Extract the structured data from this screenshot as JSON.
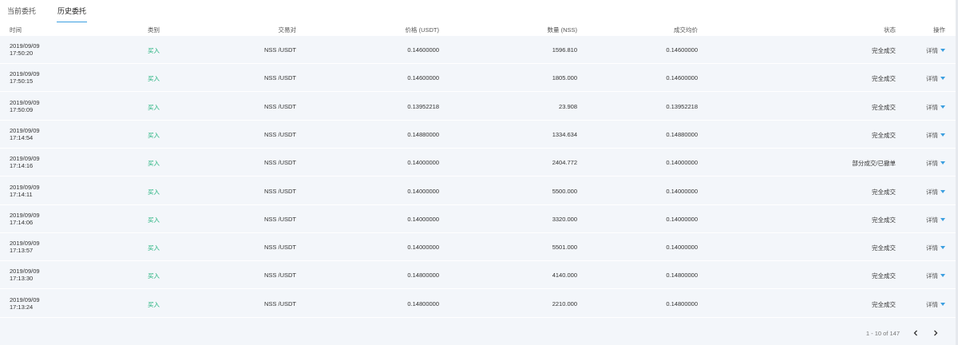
{
  "tabs": [
    {
      "label": "当前委托",
      "active": false
    },
    {
      "label": "历史委托",
      "active": true
    }
  ],
  "columns": {
    "time": "时间",
    "type": "类别",
    "pair": "交易对",
    "price": "价格 (USDT)",
    "qty": "数量 (NSS)",
    "avg": "成交均价",
    "status": "状态",
    "op": "操作"
  },
  "rows": [
    {
      "date": "2019/09/09",
      "time": "17:50:20",
      "type": "买入",
      "pair": "NSS /USDT",
      "price": "0.14600000",
      "qty": "1596.810",
      "avg": "0.14600000",
      "status": "完全成交",
      "op": "详情"
    },
    {
      "date": "2019/09/09",
      "time": "17:50:15",
      "type": "买入",
      "pair": "NSS /USDT",
      "price": "0.14600000",
      "qty": "1805.000",
      "avg": "0.14600000",
      "status": "完全成交",
      "op": "详情"
    },
    {
      "date": "2019/09/09",
      "time": "17:50:09",
      "type": "买入",
      "pair": "NSS /USDT",
      "price": "0.13952218",
      "qty": "23.908",
      "avg": "0.13952218",
      "status": "完全成交",
      "op": "详情"
    },
    {
      "date": "2019/09/09",
      "time": "17:14:54",
      "type": "买入",
      "pair": "NSS /USDT",
      "price": "0.14880000",
      "qty": "1334.634",
      "avg": "0.14880000",
      "status": "完全成交",
      "op": "详情"
    },
    {
      "date": "2019/09/09",
      "time": "17:14:16",
      "type": "买入",
      "pair": "NSS /USDT",
      "price": "0.14000000",
      "qty": "2404.772",
      "avg": "0.14000000",
      "status": "部分成交/已撤单",
      "op": "详情"
    },
    {
      "date": "2019/09/09",
      "time": "17:14:11",
      "type": "买入",
      "pair": "NSS /USDT",
      "price": "0.14000000",
      "qty": "5500.000",
      "avg": "0.14000000",
      "status": "完全成交",
      "op": "详情"
    },
    {
      "date": "2019/09/09",
      "time": "17:14:06",
      "type": "买入",
      "pair": "NSS /USDT",
      "price": "0.14000000",
      "qty": "3320.000",
      "avg": "0.14000000",
      "status": "完全成交",
      "op": "详情"
    },
    {
      "date": "2019/09/09",
      "time": "17:13:57",
      "type": "买入",
      "pair": "NSS /USDT",
      "price": "0.14000000",
      "qty": "5501.000",
      "avg": "0.14000000",
      "status": "完全成交",
      "op": "详情"
    },
    {
      "date": "2019/09/09",
      "time": "17:13:30",
      "type": "买入",
      "pair": "NSS /USDT",
      "price": "0.14800000",
      "qty": "4140.000",
      "avg": "0.14800000",
      "status": "完全成交",
      "op": "详情"
    },
    {
      "date": "2019/09/09",
      "time": "17:13:24",
      "type": "买入",
      "pair": "NSS /USDT",
      "price": "0.14800000",
      "qty": "2210.000",
      "avg": "0.14800000",
      "status": "完全成交",
      "op": "详情"
    }
  ],
  "pagination": {
    "info": "1 - 10 of 147",
    "prev_icon": "chevron-left-icon",
    "next_icon": "chevron-right-icon"
  },
  "colors": {
    "accent": "#3b9fe0",
    "buy": "#1db07a",
    "row_bg": "#f3f6fa"
  }
}
